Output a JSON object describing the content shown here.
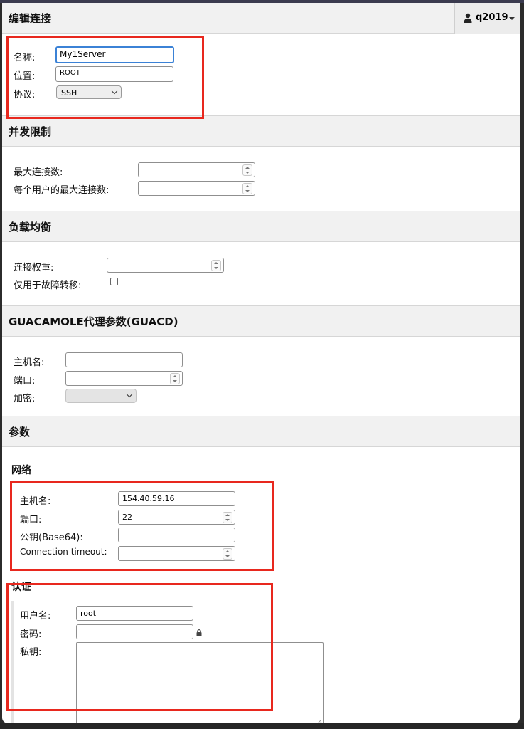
{
  "header": {
    "title": "编辑连接",
    "username": "q2019"
  },
  "basic": {
    "name_label": "名称:",
    "name_value": "My1Server",
    "location_label": "位置:",
    "location_value": "ROOT",
    "protocol_label": "协议:",
    "protocol_value": "SSH"
  },
  "concurrency": {
    "title": "并发限制",
    "max_connections_label": "最大连接数:",
    "max_per_user_label": "每个用户的最大连接数:"
  },
  "load_balancing": {
    "title": "负载均衡",
    "weight_label": "连接权重:",
    "failover_only_label": "仅用于故障转移:"
  },
  "guacd": {
    "title": "GUACAMOLE代理参数(GUACD)",
    "hostname_label": "主机名:",
    "port_label": "端口:",
    "encryption_label": "加密:"
  },
  "parameters": {
    "title": "参数",
    "network": {
      "title": "网络",
      "hostname_label": "主机名:",
      "hostname_value": "154.40.59.16",
      "port_label": "端口:",
      "port_value": "22",
      "public_key_label": "公钥(Base64):",
      "timeout_label": "Connection timeout:"
    },
    "auth": {
      "title": "认证",
      "username_label": "用户名:",
      "username_value": "root",
      "password_label": "密码:",
      "private_key_label": "私钥:"
    }
  },
  "colors": {
    "highlight": "#e8281e",
    "focus": "#3b82d6"
  },
  "icons": [
    "user-icon",
    "caret-down-icon",
    "lock-icon",
    "resize-grip-icon",
    "spinner-icon",
    "chevron-down-icon"
  ]
}
